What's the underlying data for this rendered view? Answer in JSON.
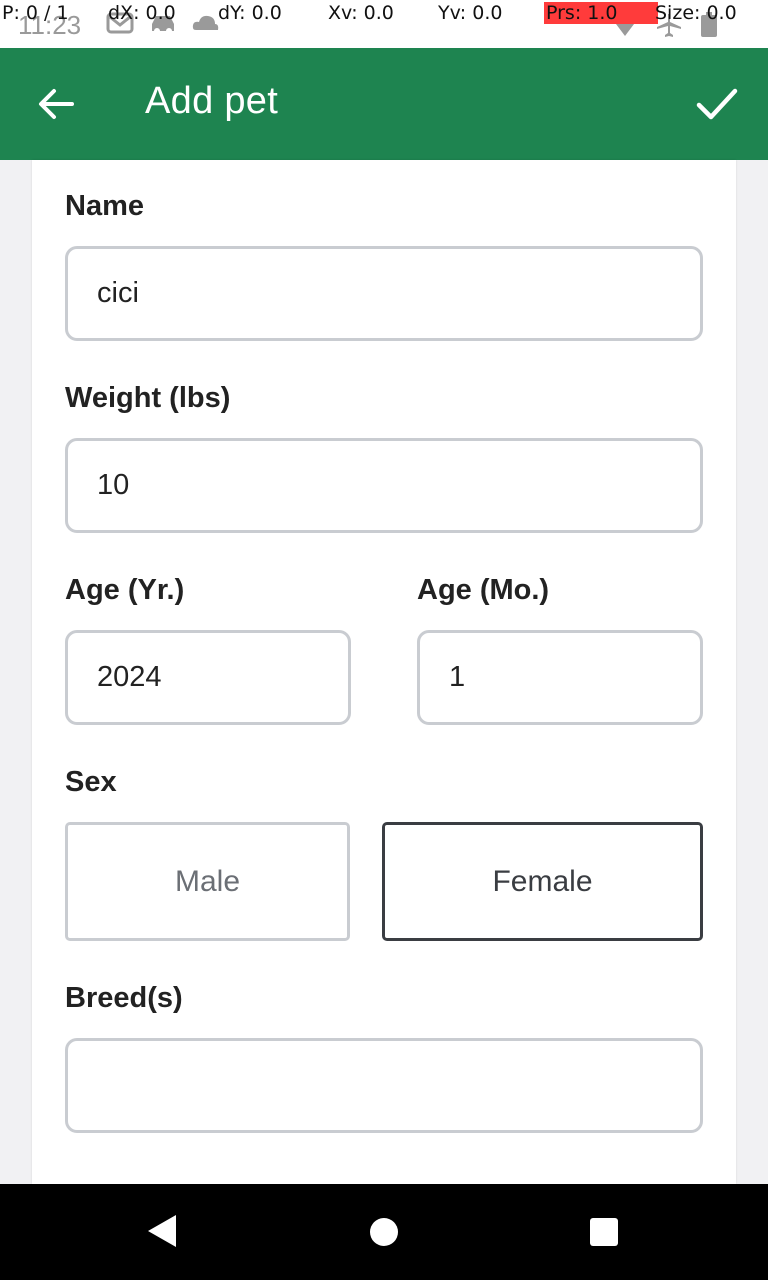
{
  "status_bar": {
    "time": "11:23",
    "debug": {
      "p": "P: 0 / 1",
      "dx": "dX: 0.0",
      "dy": "dY: 0.0",
      "xv": "Xv: 0.0",
      "yv": "Yv: 0.0",
      "prs": "Prs: 1.0",
      "size": "Size: 0.0"
    },
    "icons": [
      "gmail-icon",
      "car-icon",
      "cloud-icon",
      "wifi-icon",
      "airplane-icon",
      "battery-icon"
    ]
  },
  "app_bar": {
    "title": "Add pet",
    "back_icon": "arrow-left-icon",
    "confirm_icon": "check-icon",
    "color": "#1e8450"
  },
  "form": {
    "name": {
      "label": "Name",
      "value": "cici"
    },
    "weight": {
      "label": "Weight (lbs)",
      "value": "10"
    },
    "age_years": {
      "label": "Age (Yr.)",
      "value": "2024"
    },
    "age_months": {
      "label": "Age (Mo.)",
      "value": "1"
    },
    "sex": {
      "label": "Sex",
      "options": [
        "Male",
        "Female"
      ],
      "selected": "Female"
    },
    "breeds": {
      "label": "Breed(s)",
      "value": ""
    }
  },
  "nav_bar": {
    "icons": [
      "back-icon",
      "home-icon",
      "recents-icon"
    ]
  }
}
